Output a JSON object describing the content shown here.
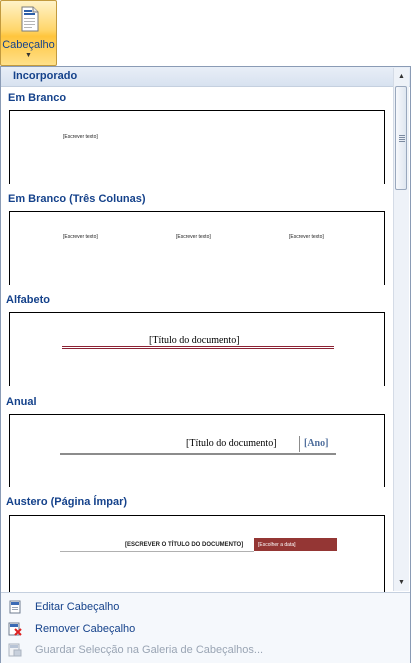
{
  "ribbon": {
    "button_label": "Cabeçalho",
    "icon": "header-page-icon"
  },
  "gallery": {
    "section_title": "Incorporado",
    "items": [
      {
        "title": "Em Branco",
        "placeholders": [
          "[Escrever texto]"
        ]
      },
      {
        "title": "Em Branco (Três Colunas)",
        "placeholders": [
          "[Escrever texto]",
          "[Escrever texto]",
          "[Escrever texto]"
        ]
      },
      {
        "title": "Alfabeto",
        "doc_title": "[Título do documento]",
        "rule_color": "#8b2234"
      },
      {
        "title": "Anual",
        "doc_title": "[Título do documento]",
        "year": "[Ano]",
        "accent": "#4f6e9c"
      },
      {
        "title": "Austero (Página Ímpar)",
        "doc_title": "[ESCREVER O TÍTULO DO DOCUMENTO]",
        "date": "[Escolher a data]",
        "accent": "#943634"
      }
    ]
  },
  "menu": {
    "items": [
      {
        "label": "Editar Cabeçalho",
        "icon": "edit-header-icon",
        "enabled": true
      },
      {
        "label": "Remover Cabeçalho",
        "icon": "remove-header-icon",
        "enabled": true
      },
      {
        "label": "Guardar Selecção na Galeria de Cabeçalhos...",
        "icon": "save-to-gallery-icon",
        "enabled": false
      }
    ]
  }
}
